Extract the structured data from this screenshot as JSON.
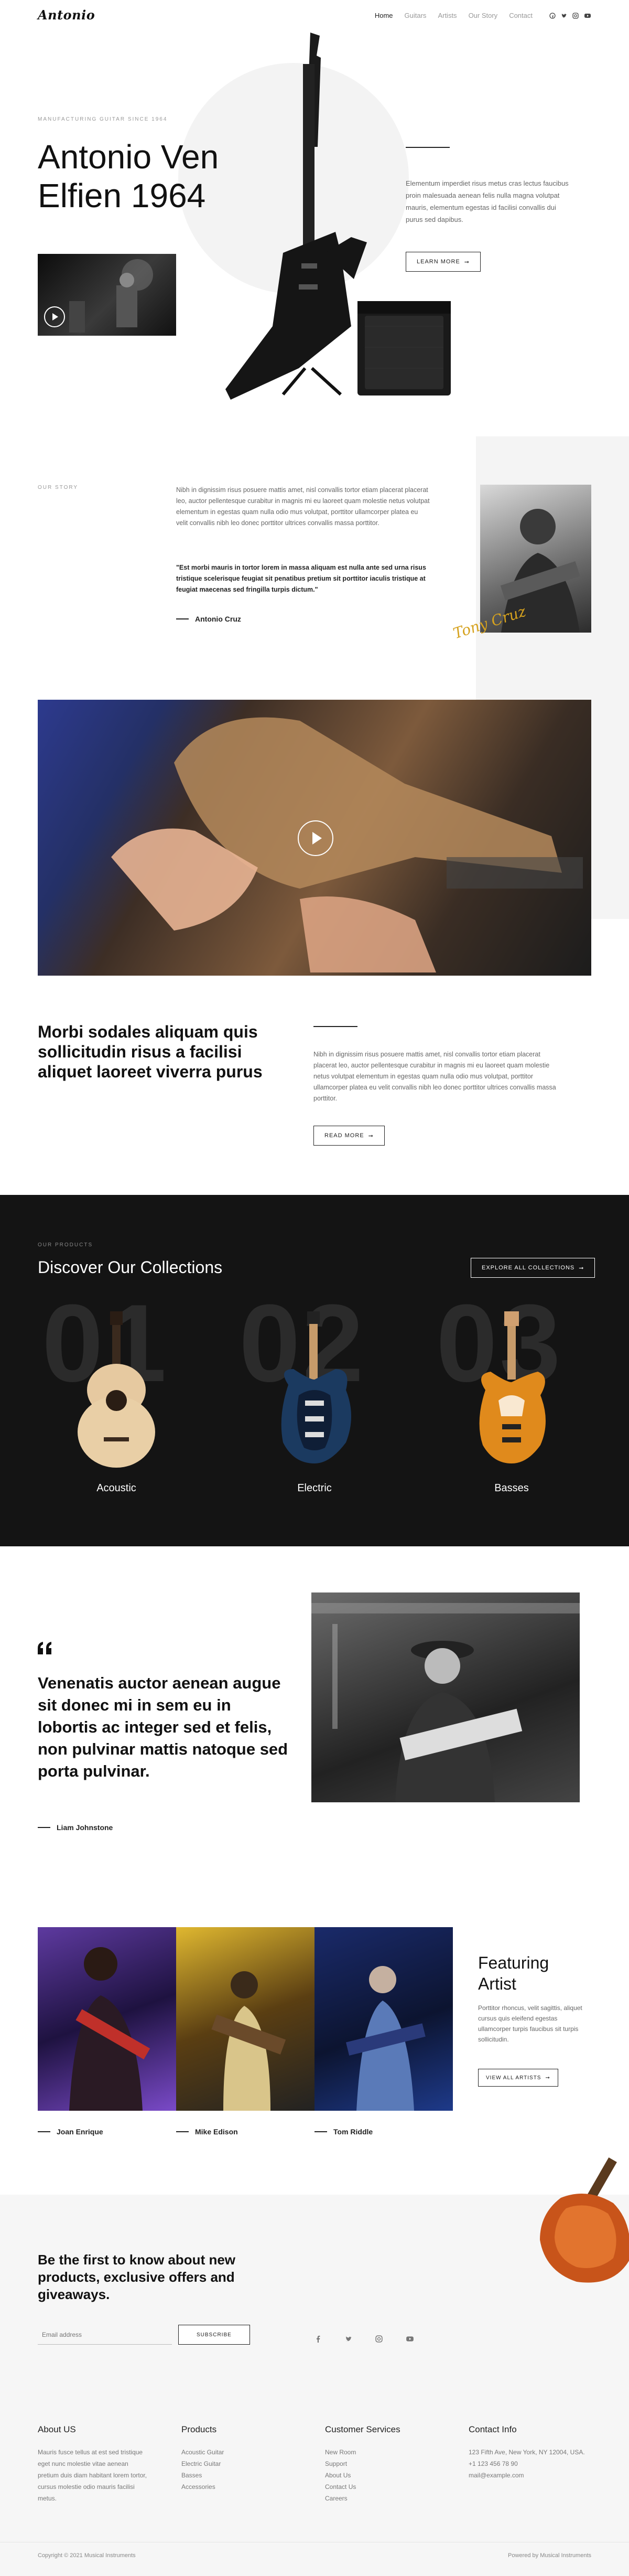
{
  "header": {
    "logo": "Antonio",
    "nav": [
      "Home",
      "Guitars",
      "Artists",
      "Our Story",
      "Contact"
    ],
    "social_icons": [
      "facebook-icon",
      "twitter-icon",
      "instagram-icon",
      "youtube-icon"
    ]
  },
  "hero": {
    "eyebrow": "Manufacturing Guitar Since 1964",
    "title_line1": "Antonio Ven",
    "title_line2": "Elfien 1964",
    "text": "Elementum imperdiet risus metus cras lectus faucibus proin malesuada aenean felis nulla magna volutpat mauris, elementum egestas id facilisi convallis dui purus sed dapibus.",
    "button": "Learn More"
  },
  "story": {
    "eyebrow": "Our Story",
    "text": "Nibh in dignissim risus posuere mattis amet, nisl convallis tortor etiam placerat placerat leo, auctor pellentesque curabitur in magnis mi eu laoreet quam molestie netus volutpat elementum in egestas quam nulla odio mus volutpat, porttitor ullamcorper platea eu velit convallis nibh leo donec porttitor ultrices convallis massa porttitor.",
    "quote": "\"Est morbi mauris in tortor lorem in massa aliquam est nulla ante sed urna risus tristique scelerisque feugiat sit penatibus pretium sit porttitor iaculis tristique at feugiat maecenas sed fringilla turpis dictum.\"",
    "author": "Antonio Cruz",
    "signature": "Tony Cruz"
  },
  "intro": {
    "title": "Morbi sodales aliquam quis sollicitudin risus a facilisi aliquet laoreet viverra purus",
    "text": "Nibh in dignissim risus posuere mattis amet, nisl convallis tortor etiam placerat placerat leo, auctor pellentesque curabitur in magnis mi eu laoreet quam molestie netus volutpat elementum in egestas quam nulla odio mus volutpat, porttitor ullamcorper platea eu velit convallis nibh leo donec porttitor ultrices convallis massa porttitor.",
    "button": "Read More"
  },
  "collections": {
    "eyebrow": "Our Products",
    "title": "Discover Our Collections",
    "button": "Explore All Collections",
    "items": [
      {
        "num": "01",
        "label": "Acoustic"
      },
      {
        "num": "02",
        "label": "Electric"
      },
      {
        "num": "03",
        "label": "Basses"
      }
    ]
  },
  "testimonial": {
    "quote": "Venenatis auctor aenean augue sit donec mi in sem eu in lobortis ac integer sed et felis, non pulvinar mattis natoque sed porta pulvinar.",
    "author": "Liam Johnstone"
  },
  "featuring": {
    "title_line1": "Featuring",
    "title_line2": "Artist",
    "text": "Porttitor rhoncus, velit sagittis, aliquet cursus quis eleifend egestas ullamcorper turpis faucibus sit turpis sollicitudin.",
    "button": "View All Artists",
    "artists": [
      "Joan Enrique",
      "Mike Edison",
      "Tom Riddle"
    ]
  },
  "newsletter": {
    "title": "Be the first to know about new products, exclusive offers and giveaways.",
    "placeholder": "Email address",
    "button": "Subscribe"
  },
  "footer": {
    "cols": [
      {
        "title": "About US",
        "text": "Mauris fusce tellus at est sed tristique eget nunc molestie vitae aenean pretium duis diam habitant lorem tortor, cursus molestie odio mauris facilisi metus."
      },
      {
        "title": "Products",
        "links": [
          "Acoustic Guitar",
          "Electric Guitar",
          "Basses",
          "Accessories"
        ]
      },
      {
        "title": "Customer Services",
        "links": [
          "New Room",
          "Support",
          "About Us",
          "Contact Us",
          "Careers"
        ]
      },
      {
        "title": "Contact Info",
        "lines": [
          "123 Fifth Ave, New York, NY 12004, USA.",
          "+1 123 456 78 90",
          "mail@example.com"
        ]
      }
    ],
    "copyright": "Copyright © 2021 Musical Instruments",
    "powered": "Powered by Musical Instruments"
  }
}
